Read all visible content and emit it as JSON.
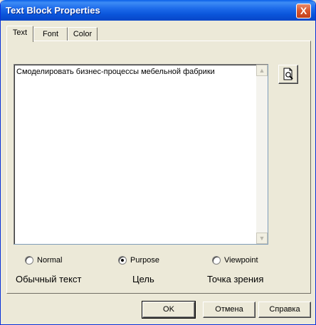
{
  "window": {
    "title": "Text Block Properties",
    "close_glyph": "X"
  },
  "tabs": [
    {
      "label": "Text",
      "active": true
    },
    {
      "label": "Font",
      "active": false
    },
    {
      "label": "Color",
      "active": false
    }
  ],
  "text_content": "Смоделировать бизнес-процессы мебельной фабрики",
  "scroll": {
    "up_glyph": "▲",
    "down_glyph": "▼"
  },
  "preview_button": {
    "icon": "magnifier-document-icon"
  },
  "radios": [
    {
      "label": "Normal",
      "checked": false
    },
    {
      "label": "Purpose",
      "checked": true
    },
    {
      "label": "Viewpoint",
      "checked": false
    }
  ],
  "captions": [
    "Обычный текст",
    "Цель",
    "Точка зрения"
  ],
  "buttons": {
    "ok": "OK",
    "cancel": "Отмена",
    "help": "Справка"
  }
}
